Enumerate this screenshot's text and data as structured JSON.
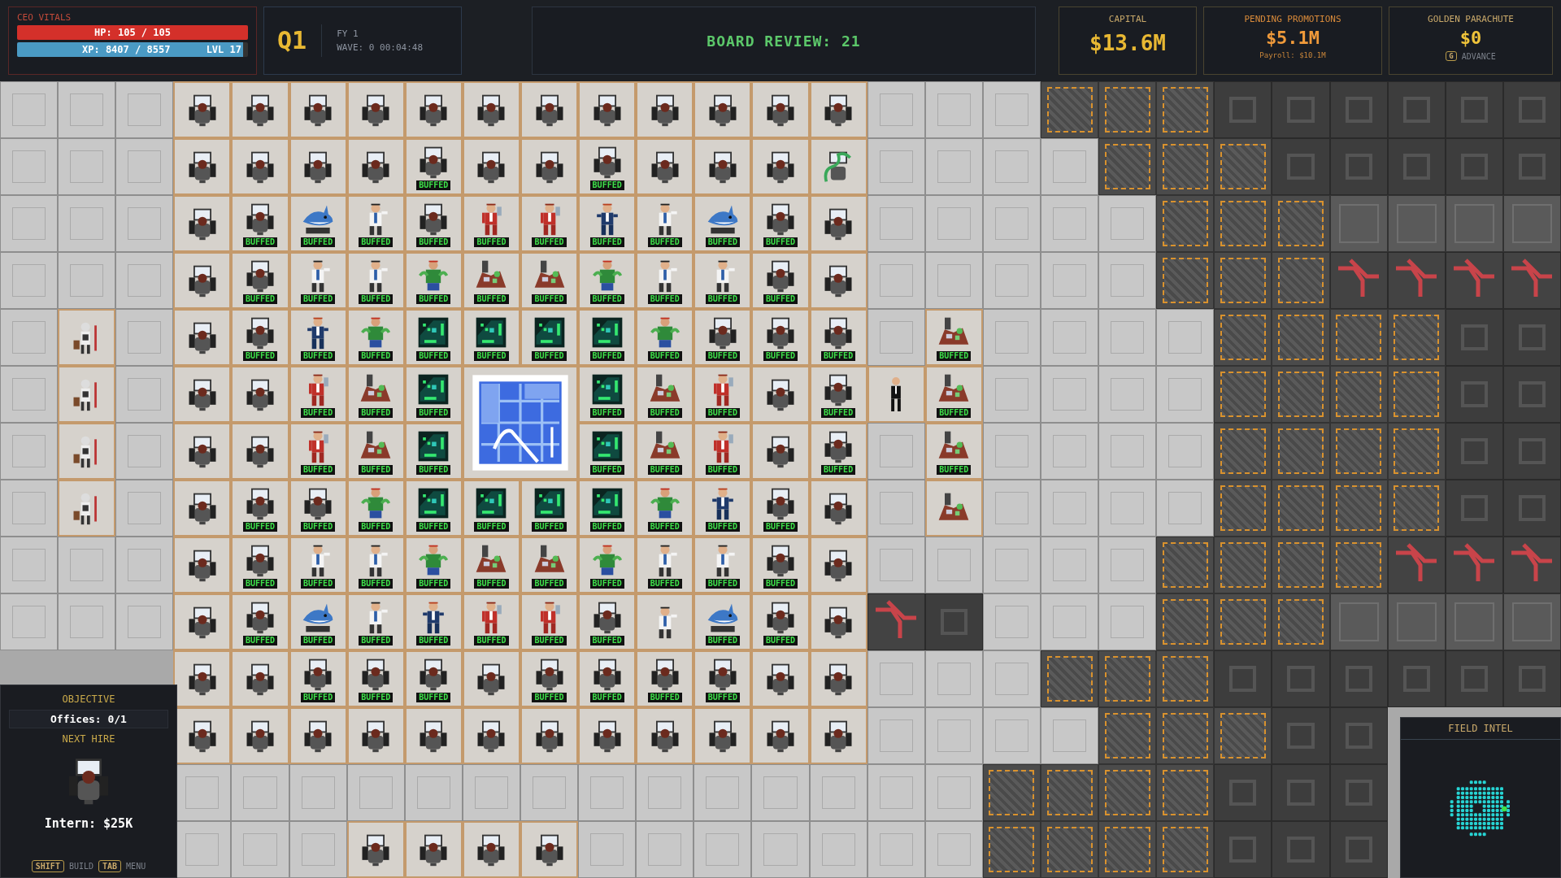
{
  "vitals": {
    "title": "CEO VITALS",
    "hp": {
      "text": "HP: 105 / 105",
      "level": 1
    },
    "xp": {
      "text": "XP: 8407 / 8557",
      "level": 0.98,
      "rank": "LVL 17"
    }
  },
  "quarter": {
    "label": "Q1",
    "year": "FY 1",
    "wave": "WAVE: 0 00:04:48"
  },
  "board_review": "BOARD REVIEW: 21",
  "stats": [
    {
      "title": "CAPITAL",
      "value": "$13.6M",
      "kind": "capital"
    },
    {
      "title": "PENDING PROMOTIONS",
      "value": "$5.1M",
      "note": "Payroll: $10.1M",
      "kind": "pending"
    },
    {
      "title": "GOLDEN PARACHUTE",
      "value": "$0",
      "key": "G",
      "action": "ADVANCE",
      "kind": "parachute"
    }
  ],
  "map": {
    "rows": [
      [
        {
          "kind": "floor"
        },
        {
          "kind": "floor"
        },
        {
          "kind": "floor"
        },
        {
          "kind": "desk"
        },
        {
          "kind": "desk"
        },
        {
          "kind": "desk"
        },
        {
          "kind": "desk"
        },
        {
          "kind": "desk"
        },
        {
          "kind": "desk"
        },
        {
          "kind": "desk"
        },
        {
          "kind": "desk"
        },
        {
          "kind": "desk"
        },
        {
          "kind": "desk"
        },
        {
          "kind": "desk"
        },
        {
          "kind": "desk"
        },
        {
          "kind": "floor"
        },
        {
          "kind": "floor"
        },
        {
          "kind": "floor"
        },
        {
          "kind": "crate"
        },
        {
          "kind": "crate"
        },
        {
          "kind": "crate"
        },
        {
          "kind": "machine"
        },
        {
          "kind": "machine"
        },
        {
          "kind": "machine"
        },
        {
          "kind": "machine"
        },
        {
          "kind": "machine"
        },
        {
          "kind": "machine"
        }
      ],
      [
        {
          "kind": "floor"
        },
        {
          "kind": "floor"
        },
        {
          "kind": "floor"
        },
        {
          "kind": "desk"
        },
        {
          "kind": "desk"
        },
        {
          "kind": "desk"
        },
        {
          "kind": "desk"
        },
        {
          "kind": "desk",
          "badge": "BUFFED"
        },
        {
          "kind": "desk"
        },
        {
          "kind": "desk"
        },
        {
          "kind": "desk",
          "badge": "BUFFED"
        },
        {
          "kind": "desk"
        },
        {
          "kind": "desk"
        },
        {
          "kind": "desk"
        },
        {
          "kind": "vine"
        },
        {
          "kind": "floor"
        },
        {
          "kind": "floor"
        },
        {
          "kind": "floor"
        },
        {
          "kind": "floor"
        },
        {
          "kind": "crate"
        },
        {
          "kind": "crate"
        },
        {
          "kind": "crate"
        },
        {
          "kind": "machine"
        },
        {
          "kind": "machine"
        },
        {
          "kind": "machine"
        },
        {
          "kind": "machine"
        },
        {
          "kind": "machine"
        }
      ],
      [
        {
          "kind": "floor"
        },
        {
          "kind": "floor"
        },
        {
          "kind": "floor"
        },
        {
          "kind": "desk"
        },
        {
          "kind": "desk",
          "badge": "BUFFED"
        },
        {
          "kind": "shark",
          "badge": "BUFFED"
        },
        {
          "kind": "guru",
          "badge": "BUFFED"
        },
        {
          "kind": "desk",
          "badge": "BUFFED"
        },
        {
          "kind": "executive",
          "badge": "BUFFED"
        },
        {
          "kind": "executive",
          "badge": "BUFFED"
        },
        {
          "kind": "manager",
          "badge": "BUFFED"
        },
        {
          "kind": "guru",
          "badge": "BUFFED"
        },
        {
          "kind": "shark",
          "badge": "BUFFED"
        },
        {
          "kind": "desk",
          "badge": "BUFFED"
        },
        {
          "kind": "desk"
        },
        {
          "kind": "floor"
        },
        {
          "kind": "floor"
        },
        {
          "kind": "floor"
        },
        {
          "kind": "floor"
        },
        {
          "kind": "floor"
        },
        {
          "kind": "crate"
        },
        {
          "kind": "crate"
        },
        {
          "kind": "crate"
        },
        {
          "kind": "plate"
        },
        {
          "kind": "plate"
        },
        {
          "kind": "plate"
        },
        {
          "kind": "plate"
        }
      ],
      [
        {
          "kind": "floor"
        },
        {
          "kind": "floor"
        },
        {
          "kind": "floor"
        },
        {
          "kind": "desk"
        },
        {
          "kind": "desk",
          "badge": "BUFFED"
        },
        {
          "kind": "guru",
          "badge": "BUFFED"
        },
        {
          "kind": "guru",
          "badge": "BUFFED"
        },
        {
          "kind": "zombie",
          "badge": "BUFFED"
        },
        {
          "kind": "pile",
          "badge": "BUFFED"
        },
        {
          "kind": "pile",
          "badge": "BUFFED"
        },
        {
          "kind": "zombie",
          "badge": "BUFFED"
        },
        {
          "kind": "guru",
          "badge": "BUFFED"
        },
        {
          "kind": "guru",
          "badge": "BUFFED"
        },
        {
          "kind": "desk",
          "badge": "BUFFED"
        },
        {
          "kind": "desk"
        },
        {
          "kind": "floor"
        },
        {
          "kind": "floor"
        },
        {
          "kind": "floor"
        },
        {
          "kind": "floor"
        },
        {
          "kind": "floor"
        },
        {
          "kind": "crate"
        },
        {
          "kind": "crate"
        },
        {
          "kind": "crate"
        },
        {
          "kind": "pipe"
        },
        {
          "kind": "pipe"
        },
        {
          "kind": "pipe"
        },
        {
          "kind": "pipe"
        }
      ],
      [
        {
          "kind": "floor"
        },
        {
          "kind": "janitor"
        },
        {
          "kind": "floor"
        },
        {
          "kind": "desk"
        },
        {
          "kind": "desk",
          "badge": "BUFFED"
        },
        {
          "kind": "manager",
          "badge": "BUFFED"
        },
        {
          "kind": "zombie",
          "badge": "BUFFED"
        },
        {
          "kind": "server",
          "badge": "BUFFED"
        },
        {
          "kind": "server",
          "badge": "BUFFED"
        },
        {
          "kind": "server",
          "badge": "BUFFED"
        },
        {
          "kind": "server",
          "badge": "BUFFED"
        },
        {
          "kind": "zombie",
          "badge": "BUFFED"
        },
        {
          "kind": "desk",
          "badge": "BUFFED"
        },
        {
          "kind": "desk",
          "badge": "BUFFED"
        },
        {
          "kind": "desk",
          "badge": "BUFFED"
        },
        {
          "kind": "floor"
        },
        {
          "kind": "pile",
          "badge": "BUFFED"
        },
        {
          "kind": "floor"
        },
        {
          "kind": "floor"
        },
        {
          "kind": "floor"
        },
        {
          "kind": "floor"
        },
        {
          "kind": "crate"
        },
        {
          "kind": "crate"
        },
        {
          "kind": "crate"
        },
        {
          "kind": "crate"
        },
        {
          "kind": "machine"
        },
        {
          "kind": "machine"
        }
      ],
      [
        {
          "kind": "floor"
        },
        {
          "kind": "janitor"
        },
        {
          "kind": "floor"
        },
        {
          "kind": "desk"
        },
        {
          "kind": "desk"
        },
        {
          "kind": "executive",
          "badge": "BUFFED"
        },
        {
          "kind": "pile",
          "badge": "BUFFED"
        },
        {
          "kind": "server",
          "badge": "BUFFED"
        },
        {
          "kind": "whiteboard"
        },
        {
          "kind": "span"
        },
        {
          "kind": "server",
          "badge": "BUFFED"
        },
        {
          "kind": "pile",
          "badge": "BUFFED"
        },
        {
          "kind": "executive",
          "badge": "BUFFED"
        },
        {
          "kind": "desk"
        },
        {
          "kind": "desk",
          "badge": "BUFFED"
        },
        {
          "kind": "suit"
        },
        {
          "kind": "pile",
          "badge": "BUFFED"
        },
        {
          "kind": "floor"
        },
        {
          "kind": "floor"
        },
        {
          "kind": "floor"
        },
        {
          "kind": "floor"
        },
        {
          "kind": "crate"
        },
        {
          "kind": "crate"
        },
        {
          "kind": "crate"
        },
        {
          "kind": "crate"
        },
        {
          "kind": "machine"
        },
        {
          "kind": "machine"
        }
      ],
      [
        {
          "kind": "floor"
        },
        {
          "kind": "janitor"
        },
        {
          "kind": "floor"
        },
        {
          "kind": "desk"
        },
        {
          "kind": "desk"
        },
        {
          "kind": "executive",
          "badge": "BUFFED"
        },
        {
          "kind": "pile",
          "badge": "BUFFED"
        },
        {
          "kind": "server",
          "badge": "BUFFED"
        },
        {
          "kind": "span"
        },
        {
          "kind": "span"
        },
        {
          "kind": "server",
          "badge": "BUFFED"
        },
        {
          "kind": "pile",
          "badge": "BUFFED"
        },
        {
          "kind": "executive",
          "badge": "BUFFED"
        },
        {
          "kind": "desk"
        },
        {
          "kind": "desk",
          "badge": "BUFFED"
        },
        {
          "kind": "floor"
        },
        {
          "kind": "pile",
          "badge": "BUFFED"
        },
        {
          "kind": "floor"
        },
        {
          "kind": "floor"
        },
        {
          "kind": "floor"
        },
        {
          "kind": "floor"
        },
        {
          "kind": "crate"
        },
        {
          "kind": "crate"
        },
        {
          "kind": "crate"
        },
        {
          "kind": "crate"
        },
        {
          "kind": "machine"
        },
        {
          "kind": "machine"
        }
      ],
      [
        {
          "kind": "floor"
        },
        {
          "kind": "janitor"
        },
        {
          "kind": "floor"
        },
        {
          "kind": "desk"
        },
        {
          "kind": "desk",
          "badge": "BUFFED"
        },
        {
          "kind": "desk",
          "badge": "BUFFED"
        },
        {
          "kind": "zombie",
          "badge": "BUFFED"
        },
        {
          "kind": "server",
          "badge": "BUFFED"
        },
        {
          "kind": "server",
          "badge": "BUFFED"
        },
        {
          "kind": "server",
          "badge": "BUFFED"
        },
        {
          "kind": "server",
          "badge": "BUFFED"
        },
        {
          "kind": "zombie",
          "badge": "BUFFED"
        },
        {
          "kind": "manager",
          "badge": "BUFFED"
        },
        {
          "kind": "desk",
          "badge": "BUFFED"
        },
        {
          "kind": "desk"
        },
        {
          "kind": "floor"
        },
        {
          "kind": "pile"
        },
        {
          "kind": "floor"
        },
        {
          "kind": "floor"
        },
        {
          "kind": "floor"
        },
        {
          "kind": "floor"
        },
        {
          "kind": "crate"
        },
        {
          "kind": "crate"
        },
        {
          "kind": "crate"
        },
        {
          "kind": "crate"
        },
        {
          "kind": "machine"
        },
        {
          "kind": "machine"
        }
      ],
      [
        {
          "kind": "floor"
        },
        {
          "kind": "floor"
        },
        {
          "kind": "floor"
        },
        {
          "kind": "desk"
        },
        {
          "kind": "desk",
          "badge": "BUFFED"
        },
        {
          "kind": "guru",
          "badge": "BUFFED"
        },
        {
          "kind": "guru",
          "badge": "BUFFED"
        },
        {
          "kind": "zombie",
          "badge": "BUFFED"
        },
        {
          "kind": "pile",
          "badge": "BUFFED"
        },
        {
          "kind": "pile",
          "badge": "BUFFED"
        },
        {
          "kind": "zombie",
          "badge": "BUFFED"
        },
        {
          "kind": "guru",
          "badge": "BUFFED"
        },
        {
          "kind": "guru",
          "badge": "BUFFED"
        },
        {
          "kind": "desk",
          "badge": "BUFFED"
        },
        {
          "kind": "desk"
        },
        {
          "kind": "floor"
        },
        {
          "kind": "floor"
        },
        {
          "kind": "floor"
        },
        {
          "kind": "floor"
        },
        {
          "kind": "floor"
        },
        {
          "kind": "crate"
        },
        {
          "kind": "crate"
        },
        {
          "kind": "crate"
        },
        {
          "kind": "crate"
        },
        {
          "kind": "pipe"
        },
        {
          "kind": "pipe"
        },
        {
          "kind": "pipe"
        }
      ],
      [
        {
          "kind": "floor"
        },
        {
          "kind": "floor"
        },
        {
          "kind": "floor"
        },
        {
          "kind": "desk"
        },
        {
          "kind": "desk",
          "badge": "BUFFED"
        },
        {
          "kind": "shark",
          "badge": "BUFFED"
        },
        {
          "kind": "guru",
          "badge": "BUFFED"
        },
        {
          "kind": "manager",
          "badge": "BUFFED"
        },
        {
          "kind": "executive",
          "badge": "BUFFED"
        },
        {
          "kind": "executive",
          "badge": "BUFFED"
        },
        {
          "kind": "desk",
          "badge": "BUFFED"
        },
        {
          "kind": "guru"
        },
        {
          "kind": "shark",
          "badge": "BUFFED"
        },
        {
          "kind": "desk",
          "badge": "BUFFED"
        },
        {
          "kind": "desk"
        },
        {
          "kind": "pipe"
        },
        {
          "kind": "machine"
        },
        {
          "kind": "floor"
        },
        {
          "kind": "floor"
        },
        {
          "kind": "floor"
        },
        {
          "kind": "crate"
        },
        {
          "kind": "crate"
        },
        {
          "kind": "crate"
        },
        {
          "kind": "plate"
        },
        {
          "kind": "plate"
        },
        {
          "kind": "plate"
        },
        {
          "kind": "plate"
        }
      ],
      [
        {
          "kind": "void"
        },
        {
          "kind": "void"
        },
        {
          "kind": "void"
        },
        {
          "kind": "desk"
        },
        {
          "kind": "desk"
        },
        {
          "kind": "desk",
          "badge": "BUFFED"
        },
        {
          "kind": "desk",
          "badge": "BUFFED"
        },
        {
          "kind": "desk",
          "badge": "BUFFED"
        },
        {
          "kind": "desk"
        },
        {
          "kind": "desk",
          "badge": "BUFFED"
        },
        {
          "kind": "desk",
          "badge": "BUFFED"
        },
        {
          "kind": "desk",
          "badge": "BUFFED"
        },
        {
          "kind": "desk",
          "badge": "BUFFED"
        },
        {
          "kind": "desk"
        },
        {
          "kind": "desk"
        },
        {
          "kind": "floor"
        },
        {
          "kind": "floor"
        },
        {
          "kind": "floor"
        },
        {
          "kind": "crate"
        },
        {
          "kind": "crate"
        },
        {
          "kind": "crate"
        },
        {
          "kind": "machine"
        },
        {
          "kind": "machine"
        },
        {
          "kind": "machine"
        },
        {
          "kind": "machine"
        },
        {
          "kind": "machine"
        },
        {
          "kind": "machine"
        }
      ],
      [
        {
          "kind": "void"
        },
        {
          "kind": "void"
        },
        {
          "kind": "void"
        },
        {
          "kind": "desk"
        },
        {
          "kind": "desk"
        },
        {
          "kind": "desk"
        },
        {
          "kind": "desk"
        },
        {
          "kind": "desk"
        },
        {
          "kind": "desk"
        },
        {
          "kind": "desk"
        },
        {
          "kind": "desk"
        },
        {
          "kind": "desk"
        },
        {
          "kind": "desk"
        },
        {
          "kind": "desk"
        },
        {
          "kind": "desk"
        },
        {
          "kind": "floor"
        },
        {
          "kind": "floor"
        },
        {
          "kind": "floor"
        },
        {
          "kind": "floor"
        },
        {
          "kind": "crate"
        },
        {
          "kind": "crate"
        },
        {
          "kind": "crate"
        },
        {
          "kind": "machine"
        },
        {
          "kind": "machine"
        },
        {
          "kind": "void"
        },
        {
          "kind": "void"
        },
        {
          "kind": "void"
        }
      ],
      [
        {
          "kind": "void"
        },
        {
          "kind": "void"
        },
        {
          "kind": "void"
        },
        {
          "kind": "floor"
        },
        {
          "kind": "floor"
        },
        {
          "kind": "floor"
        },
        {
          "kind": "floor"
        },
        {
          "kind": "floor"
        },
        {
          "kind": "floor"
        },
        {
          "kind": "floor"
        },
        {
          "kind": "floor"
        },
        {
          "kind": "floor"
        },
        {
          "kind": "floor"
        },
        {
          "kind": "floor"
        },
        {
          "kind": "floor"
        },
        {
          "kind": "floor"
        },
        {
          "kind": "floor"
        },
        {
          "kind": "crate"
        },
        {
          "kind": "crate"
        },
        {
          "kind": "crate"
        },
        {
          "kind": "crate"
        },
        {
          "kind": "machine"
        },
        {
          "kind": "machine"
        },
        {
          "kind": "machine"
        },
        {
          "kind": "void"
        },
        {
          "kind": "void"
        },
        {
          "kind": "void"
        }
      ],
      [
        {
          "kind": "void"
        },
        {
          "kind": "void"
        },
        {
          "kind": "void"
        },
        {
          "kind": "floor"
        },
        {
          "kind": "floor"
        },
        {
          "kind": "floor"
        },
        {
          "kind": "desk"
        },
        {
          "kind": "desk"
        },
        {
          "kind": "desk"
        },
        {
          "kind": "desk"
        },
        {
          "kind": "floor"
        },
        {
          "kind": "floor"
        },
        {
          "kind": "floor"
        },
        {
          "kind": "floor"
        },
        {
          "kind": "floor"
        },
        {
          "kind": "floor"
        },
        {
          "kind": "floor"
        },
        {
          "kind": "crate"
        },
        {
          "kind": "crate"
        },
        {
          "kind": "crate"
        },
        {
          "kind": "crate"
        },
        {
          "kind": "machine"
        },
        {
          "kind": "machine"
        },
        {
          "kind": "machine"
        },
        {
          "kind": "void"
        },
        {
          "kind": "void"
        },
        {
          "kind": "void"
        }
      ]
    ]
  },
  "objective": {
    "title": "OBJECTIVE",
    "progress": "Offices: 0/1",
    "complete": false,
    "next_title": "NEXT HIRE",
    "hire": "Intern: $25K",
    "hints": [
      {
        "key": "SHIFT",
        "action": "BUILD"
      },
      {
        "key": "TAB",
        "action": "MENU"
      }
    ]
  },
  "field_intel": {
    "title": "FIELD INTEL"
  }
}
